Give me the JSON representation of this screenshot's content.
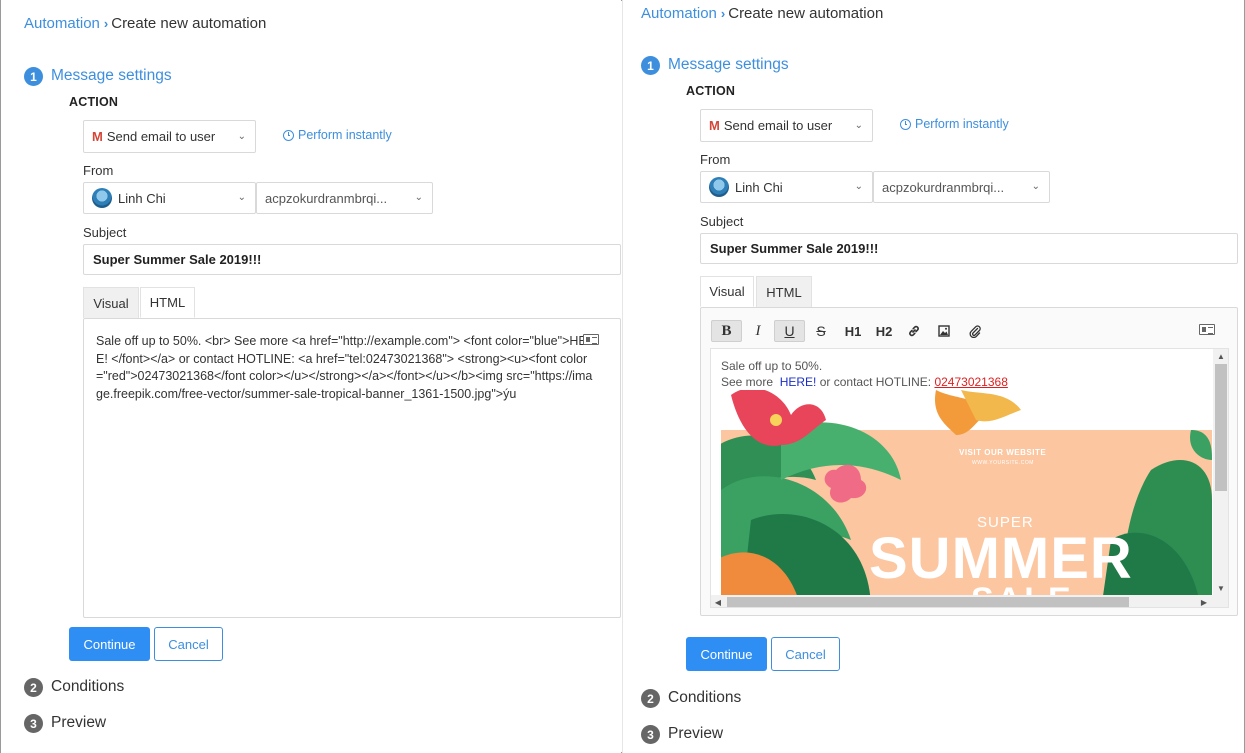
{
  "breadcrumb": {
    "parent": "Automation",
    "separator": "›",
    "current": "Create new automation"
  },
  "steps": [
    {
      "number": "1",
      "title": "Message settings"
    },
    {
      "number": "2",
      "title": "Conditions"
    },
    {
      "number": "3",
      "title": "Preview"
    }
  ],
  "action": {
    "heading": "ACTION",
    "channel_icon": "gmail-icon",
    "channel_icon_glyph": "M",
    "channel": "Send email to user",
    "timing": "Perform instantly"
  },
  "from": {
    "label": "From",
    "sender_name": "Linh Chi",
    "sender_email": "acpzokurdranmbrqi..."
  },
  "subject": {
    "label": "Subject",
    "value": "Super Summer Sale 2019!!!"
  },
  "editor": {
    "tabs": [
      "Visual",
      "HTML"
    ],
    "html_source": "Sale off up to 50%. <br> See more  <a href=\"http://example.com\"> <font color=\"blue\">HERE! </font></a> or contact HOTLINE: <a href=\"tel:02473021368\"> <strong><u><font color=\"red\">02473021368</font color></u></strong></a></font></u></b><img src=\"https://image.freepik.com/free-vector/summer-sale-tropical-banner_1361-1500.jpg\">ýu",
    "toolbar": [
      "B",
      "I",
      "U",
      "S",
      "H1",
      "H2",
      "link-icon",
      "image-icon",
      "attachment-icon"
    ],
    "visual": {
      "line1": "Sale off up to 50%.",
      "see_more": "See more",
      "here": "HERE!",
      "contact": "or contact HOTLINE:",
      "phone": "02473021368"
    },
    "banner": {
      "visit": "VISIT OUR WEBSITE",
      "small": "WWW.YOURSITE.COM",
      "super": "SUPER",
      "big": "SUMMER",
      "sale": "SALE"
    }
  },
  "buttons": {
    "continue": "Continue",
    "cancel": "Cancel"
  },
  "colors": {
    "accent": "#3d8fde",
    "primary_button": "#2f8ef4",
    "hotline_red": "#e02020"
  }
}
